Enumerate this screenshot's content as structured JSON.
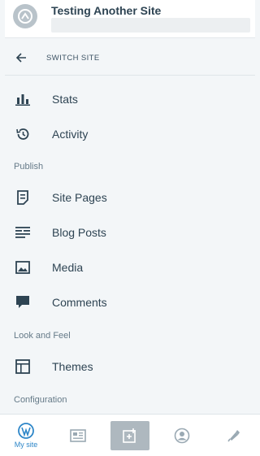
{
  "site": {
    "title": "Testing Another Site",
    "avatar_icon": "site-blavatar-icon"
  },
  "switch": {
    "label": "SWITCH SITE",
    "icon": "arrow-left-icon"
  },
  "menu": {
    "stats": "Stats",
    "activity": "Activity",
    "publish_header": "Publish",
    "site_pages": "Site Pages",
    "blog_posts": "Blog Posts",
    "media": "Media",
    "comments": "Comments",
    "look_header": "Look and Feel",
    "themes": "Themes",
    "config_header": "Configuration"
  },
  "bottom_nav": {
    "my_site_label": "My site",
    "accent": "#2d86c8",
    "icons": [
      "wordpress-icon",
      "reader-icon",
      "write-post-icon",
      "me-icon",
      "notifications-icon"
    ]
  },
  "colors": {
    "text": "#2e4453",
    "icon": "#2e4453",
    "section": "#657a88",
    "background": "#f3f6f8"
  }
}
